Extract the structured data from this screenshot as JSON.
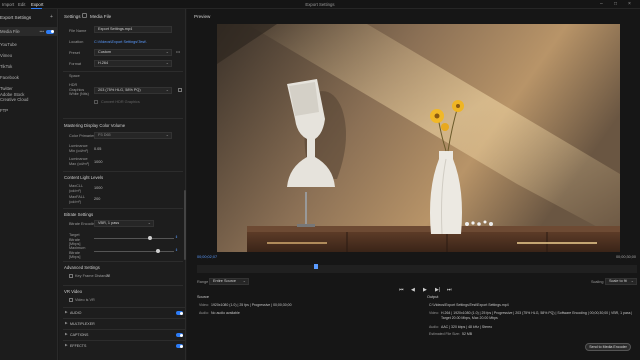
{
  "topbar": {
    "tabs": [
      "Import",
      "Edit",
      "Export"
    ],
    "active_tab": "Export",
    "title": "Export Settings"
  },
  "left_panel": {
    "title": "Export Settings",
    "items": [
      {
        "label": "Media File",
        "selected": true
      },
      {
        "label": "YouTube"
      },
      {
        "label": "Vimeo"
      },
      {
        "label": "TikTok"
      },
      {
        "label": "Facebook"
      },
      {
        "label": "Twitter"
      },
      {
        "label": "Adobe Stock"
      },
      {
        "label": "Creative Cloud"
      },
      {
        "label": "FTP"
      }
    ]
  },
  "settings": {
    "header": "Settings",
    "media_file_label": "Media File",
    "file_name_label": "File Name",
    "file_name_value": "Export Settings.mp4",
    "location_label": "Location",
    "location_value": "C:\\Videos\\Export Settings\\Test\\",
    "preset_label": "Preset",
    "preset_value": "Custom",
    "format_label": "Format",
    "format_value": "H.264",
    "space_label": "Space",
    "hdr_label": "HDR Graphics White (Nits)",
    "hdr_value": "203 (75% HLG, 58% PQ)",
    "hdr_note": "Convert HDR Graphics",
    "mastering_title": "Mastering Display Color Volume",
    "color_primaries_label": "Color Primaries",
    "color_primaries_value": "P3 D65",
    "lum_min_label": "Luminance Min (cd/m²)",
    "lum_min_value": "0.05",
    "lum_max_label": "Luminance Max (cd/m²)",
    "lum_max_value": "1000",
    "content_light_title": "Content Light Levels",
    "maxcll_label": "MaxCLL (cd/m²)",
    "maxcll_value": "1000",
    "maxfall_label": "MaxFALL (cd/m²)",
    "maxfall_value": "200",
    "bitrate_title": "Bitrate Settings",
    "bitrate_encoding_label": "Bitrate Encoding",
    "bitrate_encoding_value": "VBR, 1 pass",
    "target_label": "Target Bitrate [Mbps]",
    "max_label": "Maximum Bitrate [Mbps]",
    "target_fraction": 0.7,
    "max_fraction": 0.8,
    "advanced_title": "Advanced Settings",
    "keyframe_label": "Key Frame Distance",
    "keyframe_value": "72",
    "vr_title": "VR Video",
    "vr_label": "Video is VR",
    "accordions": [
      "AUDIO",
      "MULTIPLEXER",
      "CAPTIONS",
      "EFFECTS"
    ]
  },
  "preview": {
    "title": "Preview",
    "timecode_start": "00;00;02;07",
    "timecode_end": "00;00;30;00",
    "playhead_fraction": 0.27,
    "range_label": "Range",
    "range_value": "Entire Source",
    "scaling_label": "Scaling",
    "scaling_value": "Scale to fit",
    "source_title": "Source",
    "source_video_label": "Video:",
    "source_video_value": "1920x1080 (1.0)  |  25 fps  |  Progressive  |  00;00;30;00",
    "source_audio_label": "Audio:",
    "source_audio_value": "No audio available",
    "output_title": "Output",
    "output_path": "C:\\Videos\\Export Settings\\Test\\Export Settings.mp4",
    "output_video_label": "Video:",
    "output_video_value": "H.264  |  1920x1080 (1.0)  |  25 fps  |  Progressive  |  203 (75% HLG, 58% PQ)  |  Software Encoding  |  00;00;30;00  |  VBR, 1 pass  |  Target 20.00 Mbps, Max 20.00 Mbps",
    "output_audio_label": "Audio:",
    "output_audio_value": "AAC  |  320 kbps  |  48 kHz  |  Stereo",
    "file_size_label": "Estimated File Size:",
    "file_size_value": "52 MB",
    "send_button": "Send to Media Encoder",
    "export_button": "Export"
  },
  "colors": {
    "accent": "#2d7cf6",
    "link": "#5a9bff"
  }
}
